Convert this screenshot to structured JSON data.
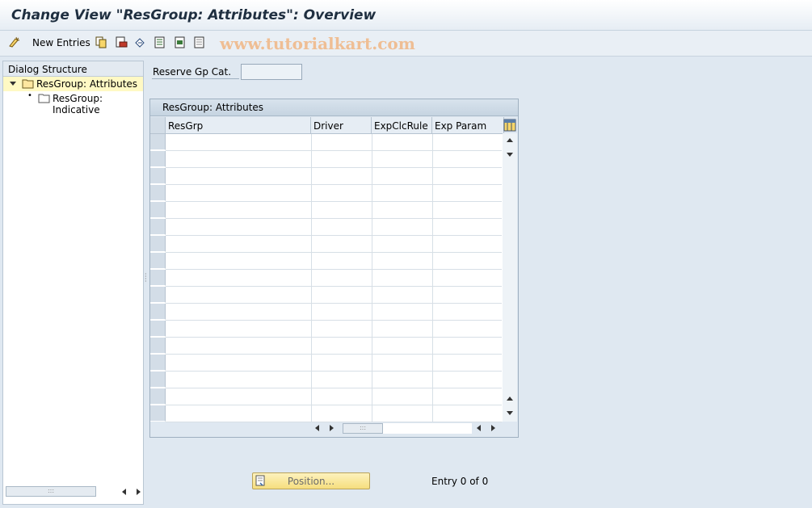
{
  "window": {
    "title": "Change View \"ResGroup: Attributes\": Overview"
  },
  "toolbar": {
    "new_entries_label": "New Entries",
    "icons": [
      "new-entries-icon",
      "copy-icon",
      "delete-icon",
      "undo-icon",
      "select-all-icon",
      "select-block-icon",
      "deselect-all-icon"
    ],
    "watermark": "www.tutorialkart.com"
  },
  "dialog_structure": {
    "header": "Dialog Structure",
    "items": [
      {
        "label": "ResGroup: Attributes",
        "selected": true,
        "expanded": true
      },
      {
        "label": "ResGroup: Indicative",
        "selected": false
      }
    ]
  },
  "filter": {
    "label": "Reserve Gp Cat.",
    "value": ""
  },
  "table": {
    "title": "ResGroup: Attributes",
    "columns": [
      "ResGrp",
      "Driver",
      "ExpClcRule",
      "Exp Param"
    ],
    "rows": []
  },
  "footer": {
    "position_button": "Position...",
    "entry_text": "Entry 0 of 0"
  }
}
